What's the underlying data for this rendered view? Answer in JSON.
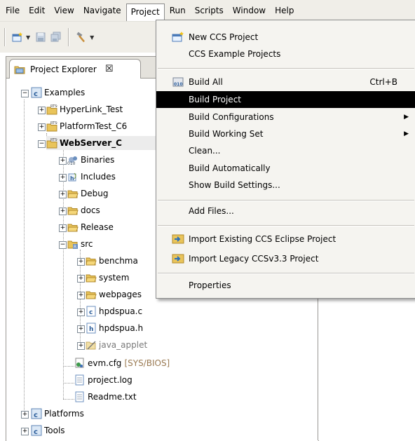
{
  "menubar": {
    "items": [
      {
        "label": "File"
      },
      {
        "label": "Edit"
      },
      {
        "label": "View"
      },
      {
        "label": "Navigate"
      },
      {
        "label": "Project"
      },
      {
        "label": "Run"
      },
      {
        "label": "Scripts"
      },
      {
        "label": "Window"
      },
      {
        "label": "Help"
      }
    ],
    "open_menu": "Project"
  },
  "toolbar": {
    "icons": [
      "new-wizard-icon",
      "save-icon",
      "save-all-icon",
      "build-hammer-icon"
    ]
  },
  "explorer": {
    "tab_label": "Project Explorer",
    "tab_close": "☒",
    "tree": [
      {
        "label": "Examples"
      },
      {
        "label": "HyperLink_Test"
      },
      {
        "label": "PlatformTest_C6"
      },
      {
        "label": "WebServer_C"
      },
      {
        "label": "Binaries"
      },
      {
        "label": "Includes"
      },
      {
        "label": "Debug"
      },
      {
        "label": "docs"
      },
      {
        "label": "Release"
      },
      {
        "label": "src"
      },
      {
        "label": "benchma"
      },
      {
        "label": "system"
      },
      {
        "label": "webpages"
      },
      {
        "label": "hpdspua.c"
      },
      {
        "label": "hpdspua.h"
      },
      {
        "label": "java_applet"
      },
      {
        "label": "evm.cfg",
        "decoration": "[SYS/BIOS]"
      },
      {
        "label": "project.log"
      },
      {
        "label": "Readme.txt"
      },
      {
        "label": "Platforms"
      },
      {
        "label": "Tools"
      }
    ]
  },
  "project_menu": {
    "items": [
      {
        "label": "New CCS Project",
        "icon": "new-project-icon"
      },
      {
        "label": "CCS Example Projects"
      },
      {
        "label": "Build All",
        "icon": "build-all-icon",
        "accelerator": "Ctrl+B"
      },
      {
        "label": "Build Project",
        "highlighted": true
      },
      {
        "label": "Build Configurations",
        "submenu": true
      },
      {
        "label": "Build Working Set",
        "submenu": true
      },
      {
        "label": "Clean..."
      },
      {
        "label": "Build Automatically"
      },
      {
        "label": "Show Build Settings..."
      },
      {
        "label": "Add Files..."
      },
      {
        "label": "Import Existing CCS Eclipse Project",
        "icon": "import-icon"
      },
      {
        "label": "Import Legacy CCSv3.3 Project",
        "icon": "import-icon"
      },
      {
        "label": "Properties"
      }
    ]
  },
  "colors": {
    "highlight": "#000000",
    "folder": "#e9c45a",
    "chrome": "#f0eee8"
  }
}
